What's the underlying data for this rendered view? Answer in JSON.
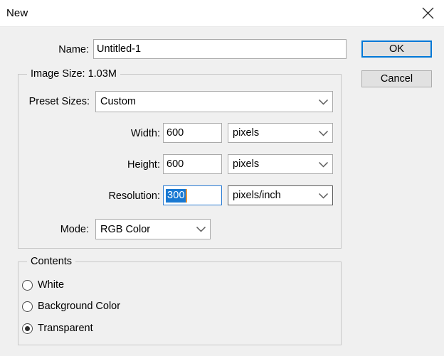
{
  "window": {
    "title": "New",
    "close_icon": "close-icon"
  },
  "name_row": {
    "label": "Name:",
    "value": "Untitled-1",
    "placeholder": ""
  },
  "buttons": {
    "ok": "OK",
    "cancel": "Cancel"
  },
  "image_size": {
    "legend": "Image Size: 1.03M",
    "preset": {
      "label": "Preset Sizes:",
      "value": "Custom"
    },
    "width": {
      "label": "Width:",
      "value": "600",
      "unit": "pixels"
    },
    "height": {
      "label": "Height:",
      "value": "600",
      "unit": "pixels"
    },
    "resolution": {
      "label": "Resolution:",
      "value": "300",
      "unit": "pixels/inch",
      "selected": true
    },
    "mode": {
      "label": "Mode:",
      "value": "RGB Color"
    }
  },
  "contents": {
    "legend": "Contents",
    "options": [
      {
        "label": "White",
        "checked": false
      },
      {
        "label": "Background Color",
        "checked": false
      },
      {
        "label": "Transparent",
        "checked": true
      }
    ]
  },
  "colors": {
    "accent": "#0078d7",
    "selection": "#1878d2",
    "caret": "#e8953a",
    "dialog_bg": "#f0f0f0",
    "titlebar_bg": "#ffffff"
  }
}
